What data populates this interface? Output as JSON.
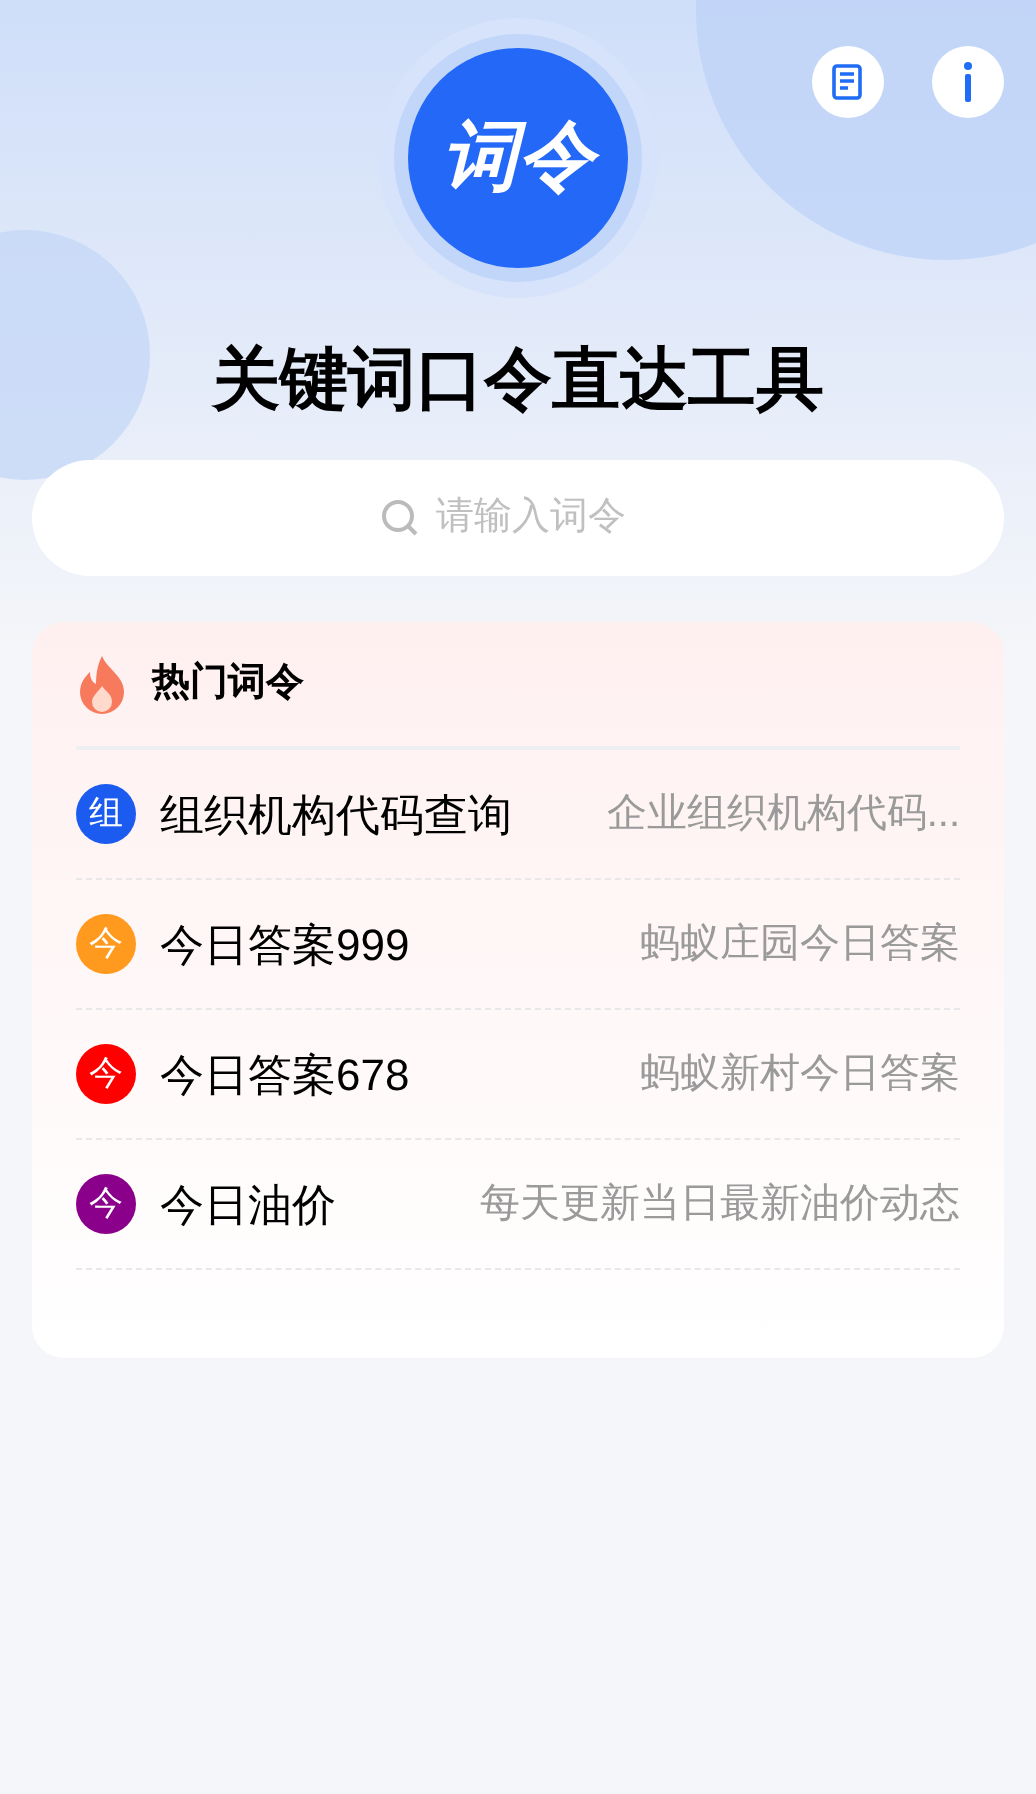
{
  "logo": {
    "text": "词令"
  },
  "title": "关键词口令直达工具",
  "search": {
    "placeholder": "请输入词令"
  },
  "hot": {
    "title": "热门词令",
    "items": [
      {
        "badge": "组",
        "color": "#1c5bf0",
        "name": "组织机构代码查询",
        "desc": "企业组织机构代码..."
      },
      {
        "badge": "今",
        "color": "#ff9a1f",
        "name": "今日答案999",
        "desc": "蚂蚁庄园今日答案"
      },
      {
        "badge": "今",
        "color": "#ff0000",
        "name": "今日答案678",
        "desc": "蚂蚁新村今日答案"
      },
      {
        "badge": "今",
        "color": "#8b008b",
        "name": "今日油价",
        "desc": "每天更新当日最新油价动态"
      }
    ]
  }
}
